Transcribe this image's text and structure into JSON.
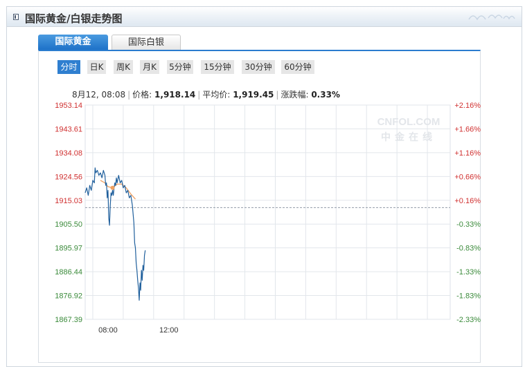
{
  "panel": {
    "title": "国际黄金/白银走势图"
  },
  "tabs": [
    {
      "label": "国际黄金",
      "active": true
    },
    {
      "label": "国际白银",
      "active": false
    }
  ],
  "periods": [
    "分时",
    "日K",
    "周K",
    "月K",
    "5分钟",
    "15分钟",
    "30分钟",
    "60分钟"
  ],
  "info": {
    "time": "8月12, 08:08",
    "price_label": "价格:",
    "price": "1,918.14",
    "avg_label": "平均价:",
    "avg": "1,919.45",
    "change_label": "涨跌幅:",
    "change": "0.33%"
  },
  "watermark": {
    "line1": "CNFOL.COM",
    "line2": "中金在线"
  },
  "colors": {
    "price_line": "#1f5f9c",
    "avg_line": "#f0a060",
    "up": "#d03030",
    "down": "#3a8a3a",
    "tab_active": "#2f7fd0"
  },
  "chart_data": {
    "type": "line",
    "y_ticks": [
      "1953.14",
      "1943.61",
      "1934.08",
      "1924.56",
      "1915.03",
      "1905.50",
      "1895.97",
      "1886.44",
      "1876.92",
      "1867.39"
    ],
    "right_ticks": [
      "+2.16%",
      "+1.66%",
      "+1.16%",
      "+0.66%",
      "+0.16%",
      "-0.33%",
      "-0.83%",
      "-1.33%",
      "-1.83%",
      "-2.33%"
    ],
    "x_ticks": [
      {
        "label": "08:00",
        "hour": 8
      },
      {
        "label": "12:00",
        "hour": 12
      }
    ],
    "ylim": [
      1867.39,
      1953.14
    ],
    "xlim": [
      6.5,
      30.5
    ],
    "grid": true,
    "reference_price": 1912.1,
    "series": [
      {
        "values": [
          [
            6.5,
            1918
          ],
          [
            6.6,
            1920
          ],
          [
            6.7,
            1917
          ],
          [
            6.8,
            1921
          ],
          [
            6.9,
            1919
          ],
          [
            7.0,
            1923
          ],
          [
            7.1,
            1922
          ],
          [
            7.15,
            1928
          ],
          [
            7.2,
            1926
          ],
          [
            7.3,
            1927
          ],
          [
            7.4,
            1925
          ],
          [
            7.5,
            1926
          ],
          [
            7.6,
            1924
          ],
          [
            7.7,
            1927
          ],
          [
            7.8,
            1925
          ],
          [
            7.85,
            1921
          ],
          [
            7.9,
            1922
          ],
          [
            7.95,
            1916
          ],
          [
            8.0,
            1919
          ],
          [
            8.05,
            1908
          ],
          [
            8.1,
            1905
          ],
          [
            8.15,
            1913
          ],
          [
            8.2,
            1918
          ],
          [
            8.25,
            1917
          ],
          [
            8.3,
            1919
          ],
          [
            8.35,
            1917
          ],
          [
            8.4,
            1920
          ],
          [
            8.45,
            1922
          ],
          [
            8.5,
            1921
          ],
          [
            8.55,
            1924
          ],
          [
            8.6,
            1922
          ],
          [
            8.7,
            1925
          ],
          [
            8.8,
            1922
          ],
          [
            8.9,
            1923
          ],
          [
            9.0,
            1920
          ],
          [
            9.1,
            1921
          ],
          [
            9.2,
            1918
          ],
          [
            9.3,
            1919
          ],
          [
            9.4,
            1916
          ],
          [
            9.5,
            1917
          ],
          [
            9.6,
            1913
          ],
          [
            9.7,
            1906
          ],
          [
            9.75,
            1898
          ],
          [
            9.8,
            1896
          ],
          [
            9.85,
            1890
          ],
          [
            9.9,
            1887
          ],
          [
            9.95,
            1883
          ],
          [
            10.0,
            1880
          ],
          [
            10.05,
            1875
          ],
          [
            10.1,
            1882
          ],
          [
            10.15,
            1879
          ],
          [
            10.2,
            1887
          ],
          [
            10.25,
            1883
          ],
          [
            10.3,
            1889
          ],
          [
            10.35,
            1887
          ],
          [
            10.4,
            1893
          ],
          [
            10.45,
            1895
          ]
        ]
      },
      {
        "values": [
          [
            7.5,
            1923
          ],
          [
            7.8,
            1922
          ],
          [
            8.0,
            1920.5
          ],
          [
            8.3,
            1920
          ],
          [
            8.6,
            1921.5
          ],
          [
            8.9,
            1921.5
          ],
          [
            9.2,
            1920
          ],
          [
            9.5,
            1917.5
          ],
          [
            9.8,
            1915.5
          ]
        ]
      }
    ]
  }
}
